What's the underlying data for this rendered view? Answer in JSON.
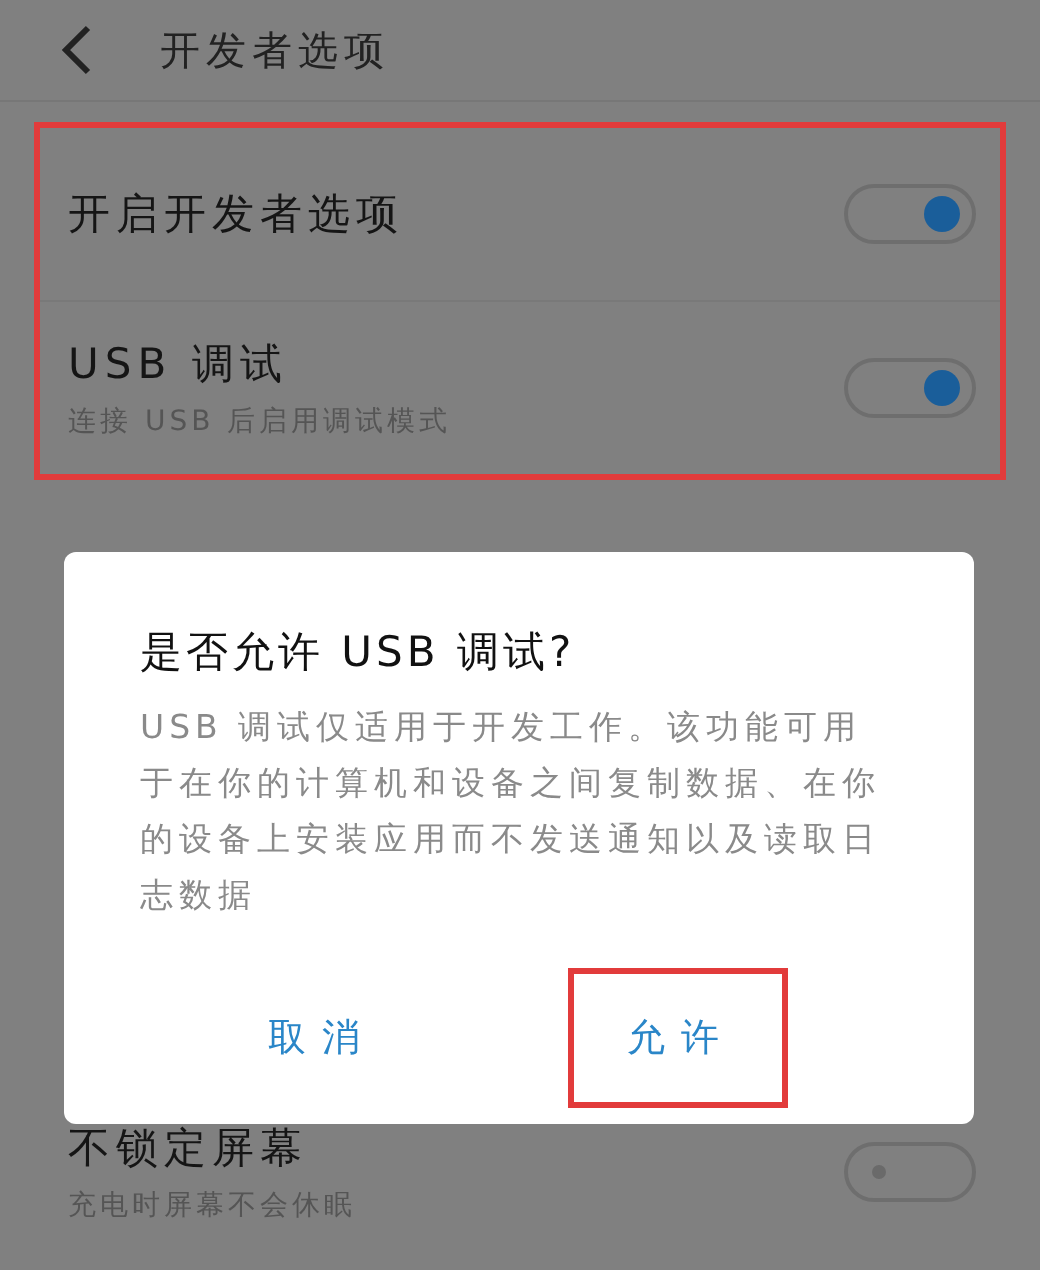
{
  "header": {
    "title": "开发者选项"
  },
  "groups": [
    {
      "highlighted": true,
      "items": [
        {
          "label": "开启开发者选项",
          "on": true
        },
        {
          "label": "USB 调试",
          "subtitle": "连接 USB 后启用调试模式",
          "on": true
        }
      ]
    },
    {
      "highlighted": false,
      "items": [
        {
          "label": "不锁定屏幕",
          "subtitle": "充电时屏幕不会休眠",
          "on": false
        }
      ]
    }
  ],
  "dialog": {
    "title": "是否允许 USB 调试?",
    "message": "USB 调试仅适用于开发工作。该功能可用于在你的计算机和设备之间复制数据、在你的设备上安装应用而不发送通知以及读取日志数据",
    "buttons": [
      {
        "label": "取消",
        "highlighted": false
      },
      {
        "label": "允许",
        "highlighted": true
      }
    ]
  }
}
